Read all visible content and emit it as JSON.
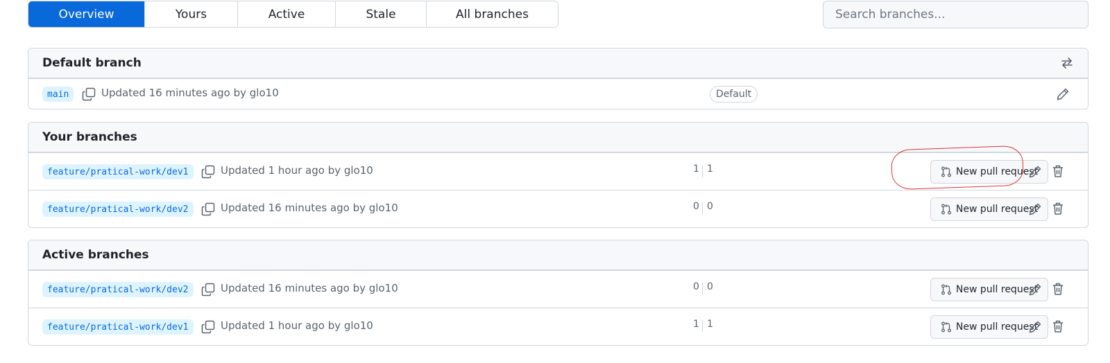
{
  "tabs": [
    {
      "label": "Overview",
      "selected": true
    },
    {
      "label": "Yours",
      "selected": false
    },
    {
      "label": "Active",
      "selected": false
    },
    {
      "label": "Stale",
      "selected": false
    },
    {
      "label": "All branches",
      "selected": false
    }
  ],
  "search": {
    "placeholder": "Search branches...",
    "value": ""
  },
  "default_section": {
    "title": "Default branch",
    "icon": "switch-arrows-icon",
    "row": {
      "branch": "main",
      "updated": "Updated 16 minutes ago by glo10",
      "badge": "Default"
    }
  },
  "your_section": {
    "title": "Your branches",
    "rows": [
      {
        "branch": "feature/pratical-work/dev1",
        "updated": "Updated 1 hour ago by glo10",
        "behind": "1",
        "ahead": "1",
        "pr_label": "New pull request"
      },
      {
        "branch": "feature/pratical-work/dev2",
        "updated": "Updated 16 minutes ago by glo10",
        "behind": "0",
        "ahead": "0",
        "pr_label": "New pull request"
      }
    ]
  },
  "active_section": {
    "title": "Active branches",
    "rows": [
      {
        "branch": "feature/pratical-work/dev2",
        "updated": "Updated 16 minutes ago by glo10",
        "behind": "0",
        "ahead": "0",
        "pr_label": "New pull request"
      },
      {
        "branch": "feature/pratical-work/dev1",
        "updated": "Updated 1 hour ago by glo10",
        "behind": "1",
        "ahead": "1",
        "pr_label": "New pull request"
      }
    ]
  },
  "colors": {
    "accent": "#0969da",
    "annotation": "#d93636",
    "tag_bg": "#ddf4ff"
  }
}
